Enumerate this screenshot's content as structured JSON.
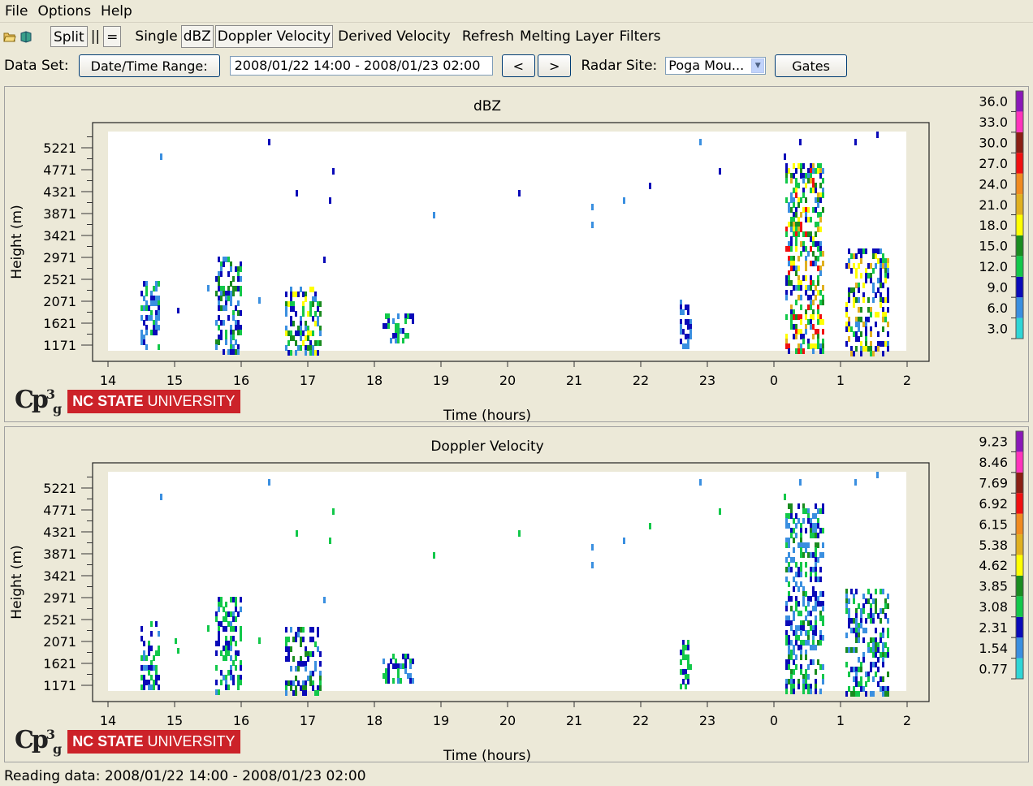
{
  "menu": {
    "items": [
      "File",
      "Options",
      "Help"
    ]
  },
  "toolbar": {
    "split_label": "Split",
    "sep_label": "||",
    "equal_label": "=",
    "single_label": "Single",
    "toggles": [
      "dBZ",
      "Doppler Velocity",
      "Derived Velocity",
      "Refresh",
      "Melting Layer",
      "Filters"
    ]
  },
  "dataset": {
    "label": "Data Set:",
    "range_button": "Date/Time Range:",
    "range_value": "2008/01/22 14:00 - 2008/01/23 02:00",
    "prev": "<",
    "next": ">",
    "site_label": "Radar Site:",
    "site_value": "Poga Mou...",
    "gates_button": "Gates"
  },
  "logo": {
    "cp": "Cp",
    "cp_sup": "3",
    "cp_sub": "g",
    "ncsu_bold": "NC STATE",
    "ncsu_rest": " UNIVERSITY"
  },
  "status": "Reading data: 2008/01/22 14:00 - 2008/01/23 02:00",
  "colors": {
    "scale": [
      "#2fd6d6",
      "#3a8fe0",
      "#0a0ab8",
      "#12c84a",
      "#1a8c20",
      "#ffff00",
      "#e0b020",
      "#f08a20",
      "#f01010",
      "#8a1f14",
      "#ff33bb",
      "#8a18b8"
    ]
  },
  "chart_data": [
    {
      "type": "heatmap",
      "title": "dBZ",
      "xlabel": "Time (hours)",
      "ylabel": "Height (m)",
      "x_ticks": [
        "14",
        "15",
        "16",
        "17",
        "18",
        "19",
        "20",
        "21",
        "22",
        "23",
        "0",
        "1",
        "2"
      ],
      "y_ticks": [
        "1171",
        "1621",
        "2071",
        "2521",
        "2971",
        "3421",
        "3871",
        "4321",
        "4771",
        "5221"
      ],
      "colorbar_ticks": [
        "3.0",
        "6.0",
        "9.0",
        "12.0",
        "15.0",
        "18.0",
        "21.0",
        "24.0",
        "27.0",
        "30.0",
        "33.0",
        "36.0"
      ]
    },
    {
      "type": "heatmap",
      "title": "Doppler Velocity",
      "xlabel": "Time (hours)",
      "ylabel": "Height (m)",
      "x_ticks": [
        "14",
        "15",
        "16",
        "17",
        "18",
        "19",
        "20",
        "21",
        "22",
        "23",
        "0",
        "1",
        "2"
      ],
      "y_ticks": [
        "1171",
        "1621",
        "2071",
        "2521",
        "2971",
        "3421",
        "3871",
        "4321",
        "4771",
        "5221"
      ],
      "colorbar_ticks": [
        "0.77",
        "1.54",
        "2.31",
        "3.08",
        "3.85",
        "4.62",
        "5.38",
        "6.15",
        "6.92",
        "7.69",
        "8.46",
        "9.23"
      ]
    }
  ]
}
